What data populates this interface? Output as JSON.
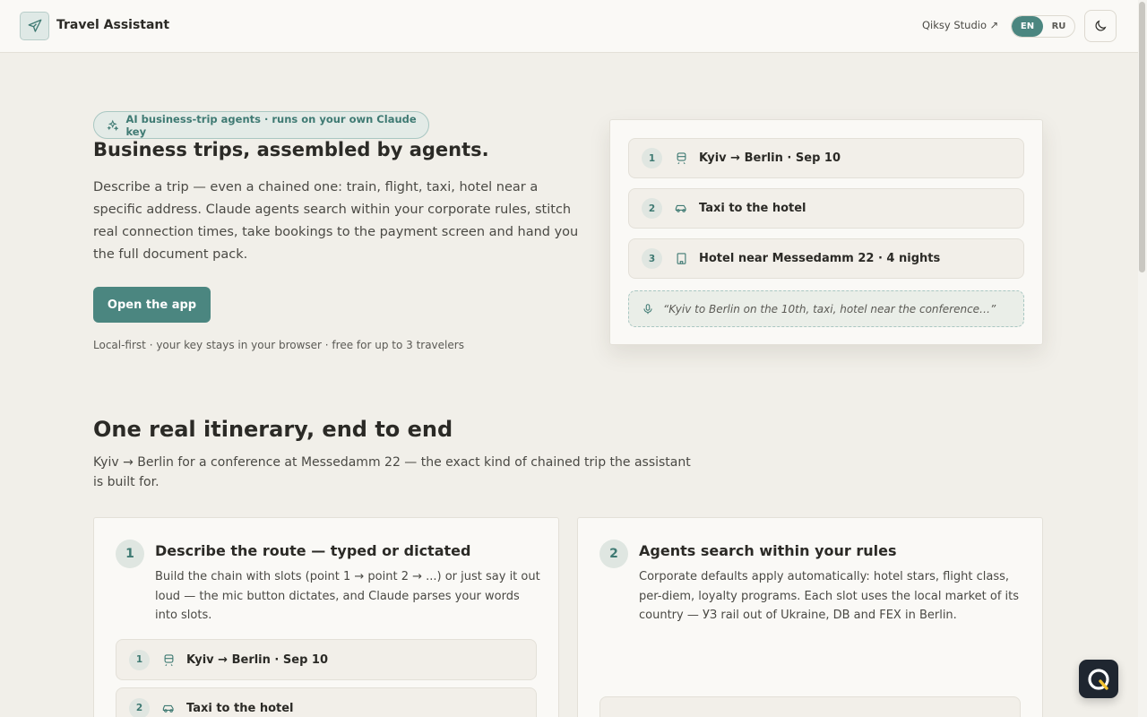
{
  "header": {
    "brand_name": "Travel Assistant",
    "studio_link": "Qiksy Studio ↗",
    "languages": [
      "EN",
      "RU"
    ],
    "active_language": "EN"
  },
  "hero": {
    "badge": "AI business-trip agents · runs on your own Claude key",
    "title": "Business trips, assembled by agents.",
    "description": "Describe a trip — even a chained one: train, flight, taxi, hotel near a specific address. Claude agents search within your corporate rules, stitch real connection times, take bookings to the payment screen and hand you the full document pack.",
    "cta": "Open the app",
    "note": "Local-first · your key stays in your browser · free for up to 3 travelers"
  },
  "preview": {
    "slots": [
      {
        "num": "1",
        "icon": "train-icon",
        "label": "Kyiv → Berlin · Sep 10"
      },
      {
        "num": "2",
        "icon": "car-icon",
        "label": "Taxi to the hotel"
      },
      {
        "num": "3",
        "icon": "hotel-icon",
        "label": "Hotel near Messedamm 22 · 4 nights"
      }
    ],
    "dictation": "“Kyiv to Berlin on the 10th, taxi, hotel near the conference…”"
  },
  "section": {
    "title": "One real itinerary, end to end",
    "description": "Kyiv → Berlin for a conference at Messedamm 22 — the exact kind of chained trip the assistant is built for."
  },
  "steps": [
    {
      "num": "1",
      "title": "Describe the route — typed or dictated",
      "description": "Build the chain with slots (point 1 → point 2 → ...) or just say it out loud — the mic button dictates, and Claude parses your words into slots.",
      "slots": [
        {
          "num": "1",
          "label": "Kyiv → Berlin · Sep 10"
        },
        {
          "num": "2",
          "label": "Taxi to the hotel"
        }
      ]
    },
    {
      "num": "2",
      "title": "Agents search within your rules",
      "description": "Corporate defaults apply automatically: hotel stars, flight class, per-diem, loyalty programs. Each slot uses the local market of its country — УЗ rail out of Ukraine, DB and FEX in Berlin."
    }
  ],
  "colors": {
    "accent": "#4b8680",
    "background": "#f1efe9",
    "card": "#faf9f6"
  }
}
